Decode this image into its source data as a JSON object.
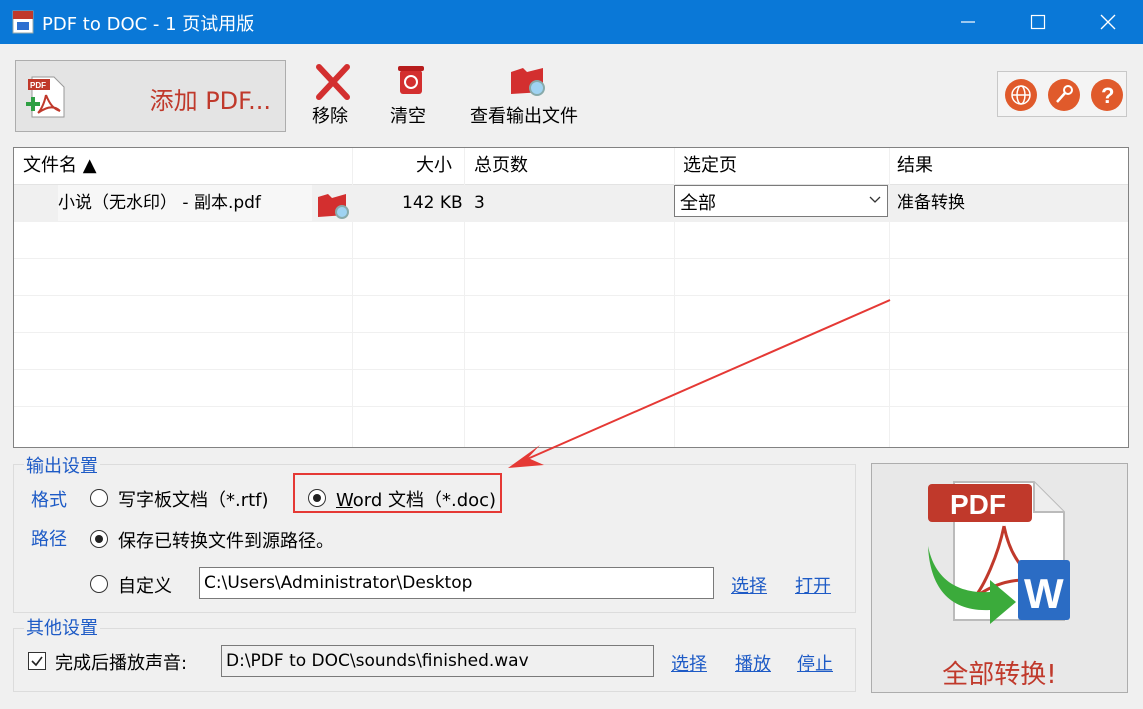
{
  "window": {
    "title": "PDF to DOC - 1 页试用版"
  },
  "toolbar": {
    "add_pdf": "添加 PDF...",
    "remove": "移除",
    "clear": "清空",
    "view_output": "查看输出文件"
  },
  "file_list": {
    "columns": {
      "name": "文件名 ▲",
      "size": "大小",
      "pages": "总页数",
      "selected_pages": "选定页",
      "result": "结果"
    },
    "rows": [
      {
        "name": "小说（无水印） - 副本.pdf",
        "size": "142 KB",
        "pages": "3",
        "selected_pages": "全部",
        "result": "准备转换"
      }
    ]
  },
  "output_settings": {
    "title": "输出设置",
    "format_label": "格式",
    "format_rtf": "写字板文档（*.rtf)",
    "format_doc_u": "W",
    "format_doc_rest": "ord 文档（*.doc)",
    "selected_format": "doc",
    "path_label": "路径",
    "path_source": "保存已转换文件到源路径。",
    "path_custom": "自定义",
    "custom_path_value": "C:\\Users\\Administrator\\Desktop",
    "select_link": "选择",
    "open_link": "打开"
  },
  "other_settings": {
    "title": "其他设置",
    "play_sound_label": "完成后播放声音:",
    "play_sound_checked": true,
    "sound_path": "D:\\PDF to DOC\\sounds\\finished.wav",
    "select_link": "选择",
    "play_link": "播放",
    "stop_link": "停止"
  },
  "convert_button": {
    "label": "全部转换!"
  },
  "colors": {
    "titlebar": "#0a78d7",
    "link_blue": "#1e5bc6",
    "accent_red": "#c0392b",
    "annotation_red": "#e53935"
  }
}
